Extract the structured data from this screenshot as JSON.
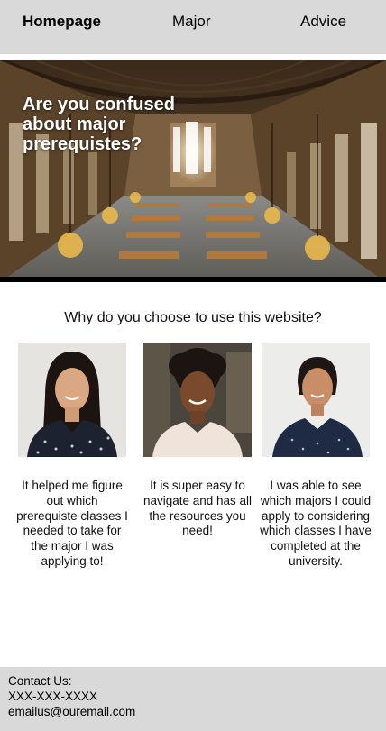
{
  "nav": {
    "home_label": "Homepage",
    "major_label": "Major",
    "advice_label": "Advice"
  },
  "hero": {
    "title": "Are you confused about major prerequistes?"
  },
  "testimonials": {
    "question": "Why do you choose to use this website?",
    "items": [
      {
        "text": "It helped me figure out which prerequiste classes I needed to take for the major I was applying to!"
      },
      {
        "text": "It is super easy to navigate and has all the resources you need!"
      },
      {
        "text": "I was able to see which majors I could apply to considering which classes I have completed at the university."
      }
    ]
  },
  "footer": {
    "heading": "Contact Us:",
    "phone": "XXX-XXX-XXXX",
    "email": "emailus@ouremail.com"
  },
  "colors": {
    "nav_background": "#d9d9d9",
    "footer_background": "#d9d9d9",
    "hero_text": "#ffffff"
  }
}
